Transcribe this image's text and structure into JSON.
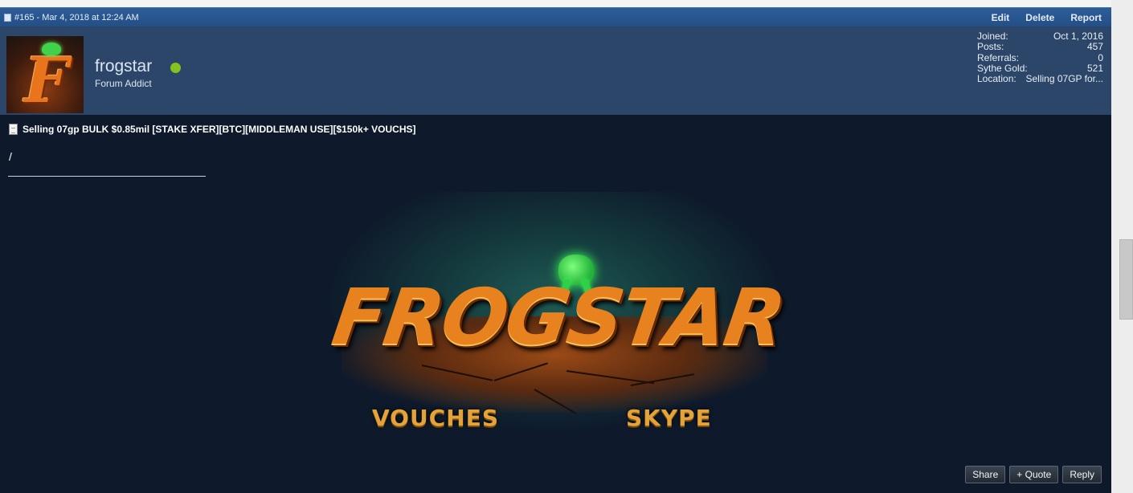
{
  "post": {
    "number_date": "#165 - Mar 4, 2018 at 12:24 AM",
    "actions": [
      "Edit",
      "Delete",
      "Report"
    ],
    "title": "Selling 07gp BULK $0.85mil [STAKE XFER][BTC][MIDDLEMAN USE][$150k+ VOUCHS]",
    "body": "/"
  },
  "user": {
    "name": "frogstar",
    "rank": "Forum Addict",
    "avatar_letter": "F",
    "online": true,
    "stats": [
      {
        "label": "Joined:",
        "value": "Oct 1, 2016"
      },
      {
        "label": "Posts:",
        "value": "457"
      },
      {
        "label": "Referrals:",
        "value": "0"
      },
      {
        "label": "Sythe Gold:",
        "value": "521"
      },
      {
        "label": "Location:",
        "value": "Selling 07GP for..."
      }
    ]
  },
  "banner": {
    "logo": "FROGSTAR",
    "left_label": "VOUCHES",
    "right_label": "SKYPE"
  },
  "buttons": {
    "share": "Share",
    "quote": "+ Quote",
    "reply": "Reply"
  },
  "colors": {
    "header_blue": "#2d5d99",
    "user_bar": "#2b4668",
    "post_bg": "#0e1a2b",
    "online_green": "#85c21c",
    "logo_orange": "#e8821f"
  }
}
